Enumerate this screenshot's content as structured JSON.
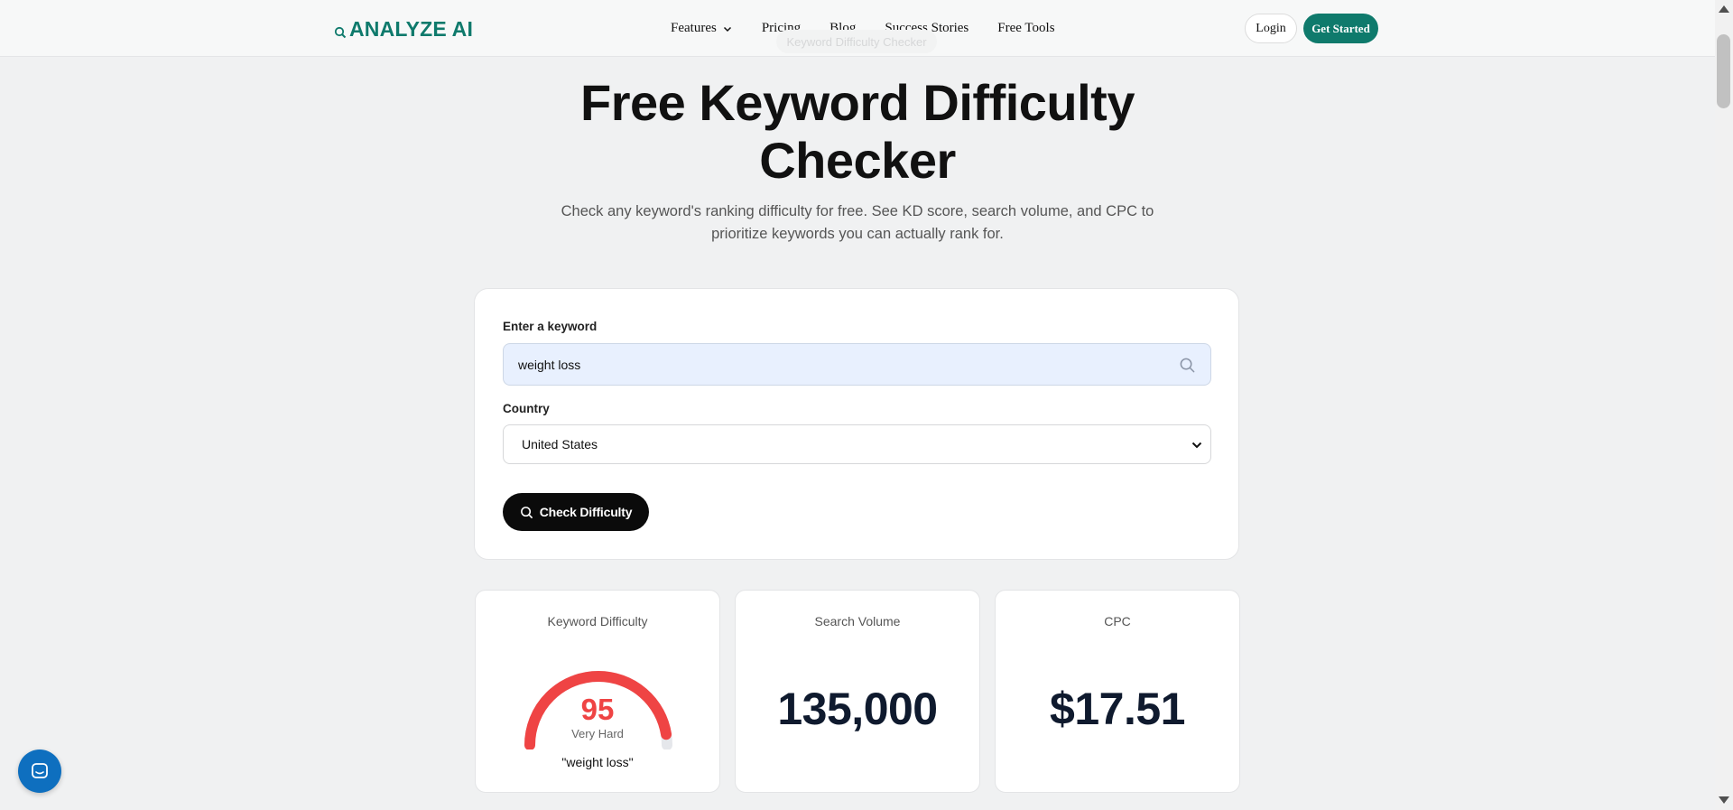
{
  "nav": {
    "logo": "ANALYZE AI",
    "links": [
      "Features",
      "Pricing",
      "Blog",
      "Success Stories",
      "Free Tools"
    ],
    "login": "Login",
    "get_started": "Get Started",
    "pill": "Keyword Difficulty Checker"
  },
  "hero": {
    "title": "Free Keyword Difficulty Checker",
    "subtitle": "Check any keyword's ranking difficulty for free. See KD score, search volume, and CPC to prioritize keywords you can actually rank for."
  },
  "form": {
    "keyword_label": "Enter a keyword",
    "keyword_value": "weight loss",
    "country_label": "Country",
    "country_value": "United States",
    "check_button": "Check Difficulty"
  },
  "metrics": {
    "kd": {
      "title": "Keyword Difficulty",
      "score": "95",
      "level": "Very Hard",
      "keyword": "\"weight loss\"",
      "fraction": 0.95,
      "color": "#ef4444"
    },
    "volume": {
      "title": "Search Volume",
      "value": "135,000"
    },
    "cpc": {
      "title": "CPC",
      "value": "$17.51"
    }
  },
  "colors": {
    "brand": "#0f7a6c",
    "primary_button": "#0b0b0b",
    "chat": "#0e6fbf"
  },
  "icons": {
    "logo": "logo-mark-icon",
    "features": "chevron-down-icon",
    "search": "search-icon",
    "select": "chevron-down-icon",
    "chat": "chat-icon"
  }
}
